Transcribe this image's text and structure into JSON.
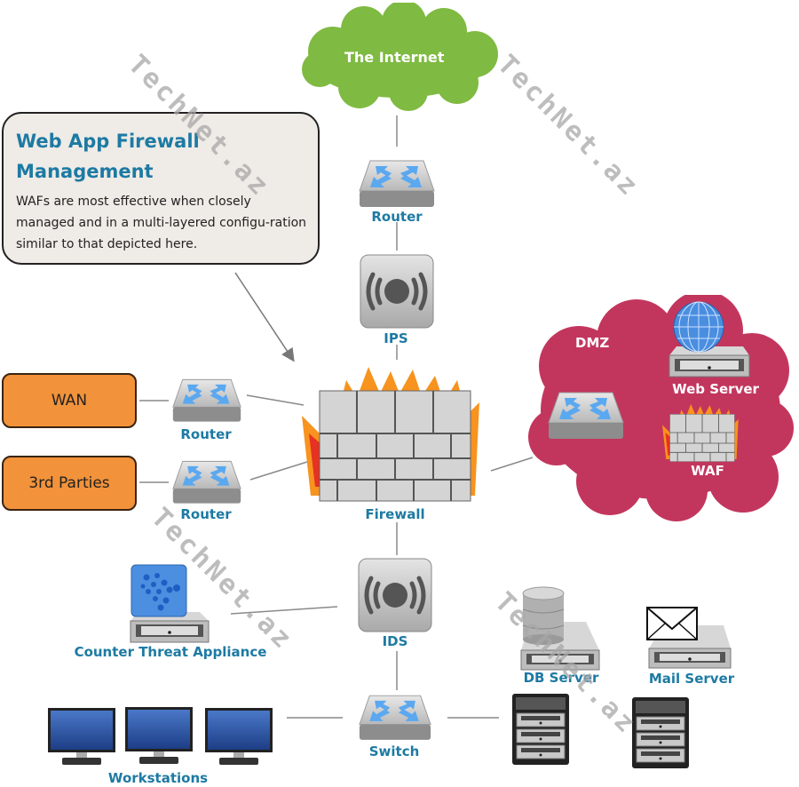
{
  "callout": {
    "title_line1": "Web App Firewall",
    "title_line2": "Management",
    "body": "WAFs are most effective when closely managed and in a multi-layered configu-ration similar to that depicted here."
  },
  "clouds": {
    "internet": {
      "label": "The Internet",
      "color": "#7fba42"
    },
    "dmz": {
      "label": "DMZ",
      "color": "#c2365e"
    }
  },
  "external_networks": [
    {
      "label": "WAN",
      "color": "#f2923a"
    },
    {
      "label": "3rd Parties",
      "color": "#f2923a"
    }
  ],
  "nodes": {
    "router_top": "Router",
    "ips": "IPS",
    "firewall": "Firewall",
    "router_wan": "Router",
    "router_3rd": "Router",
    "web_server": "Web Server",
    "waf": "WAF",
    "ids": "IDS",
    "counter_threat": "Counter Threat Appliance",
    "db_server": "DB Server",
    "mail_server": "Mail Server",
    "switch": "Switch",
    "workstations": "Workstations"
  },
  "watermark": "TechNet.az",
  "colors": {
    "label_blue": "#1d7aa3",
    "line_gray": "#888888"
  }
}
